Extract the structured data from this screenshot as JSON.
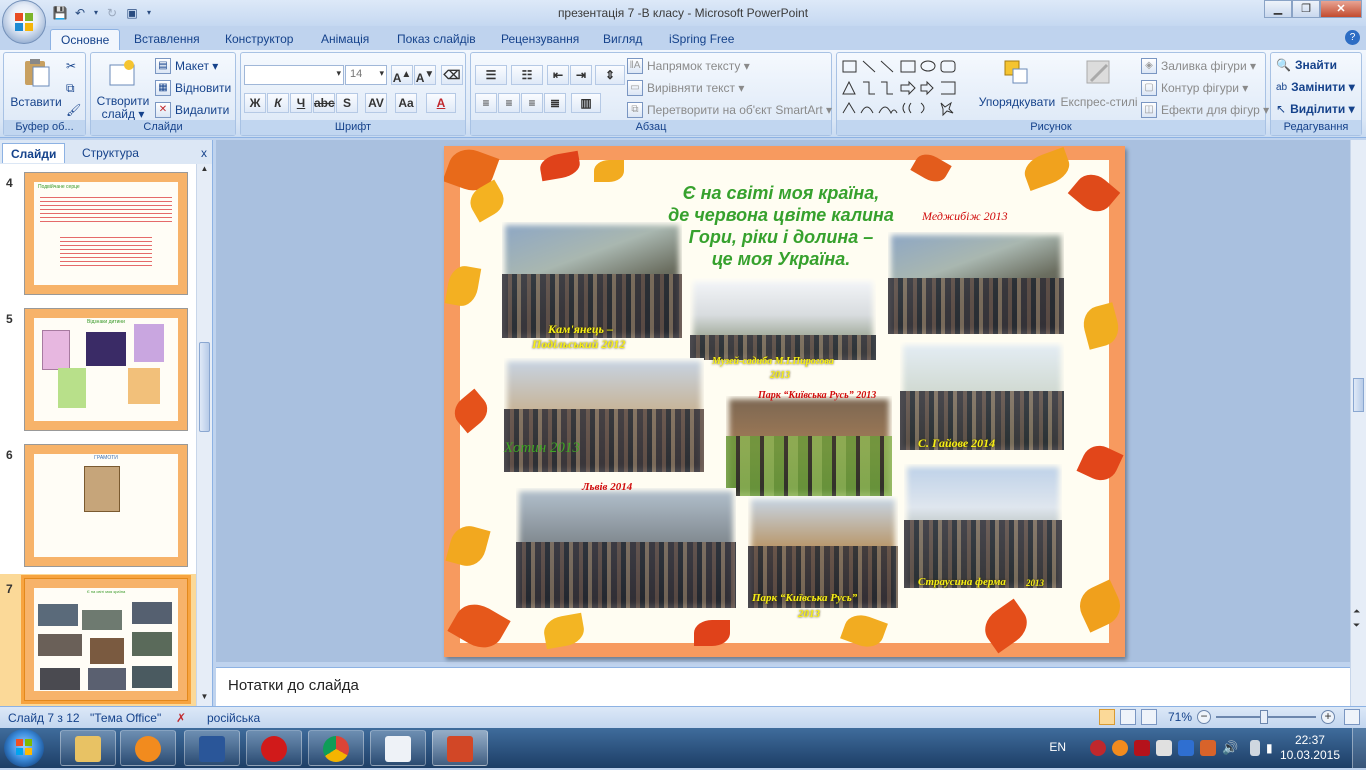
{
  "window": {
    "title": "презентація 7 -В класу  -  Microsoft PowerPoint",
    "controls": {
      "minimize": "▁",
      "maximize": "❐",
      "close": "✕"
    }
  },
  "ribbon_tabs": [
    "Основне",
    "Вставлення",
    "Конструктор",
    "Анімація",
    "Показ слайдів",
    "Рецензування",
    "Вигляд",
    "iSpring Free"
  ],
  "ribbon": {
    "clipboard": {
      "paste": "Вставити",
      "label": "Буфер об..."
    },
    "slides": {
      "new_slide": "Створити слайд ▾",
      "layout": "Макет ▾",
      "reset": "Відновити",
      "delete": "Видалити",
      "label": "Слайди"
    },
    "font": {
      "font_name": "",
      "font_size": "14",
      "label": "Шрифт"
    },
    "paragraph": {
      "text_direction": "Напрямок тексту ▾",
      "align_text": "Вирівняти текст ▾",
      "smartart": "Перетворити на об'єкт SmartArt ▾",
      "label": "Абзац"
    },
    "drawing": {
      "arrange": "Упорядкувати",
      "quick_styles": "Експрес-стилі",
      "fill": "Заливка фігури ▾",
      "outline": "Контур фігури ▾",
      "effects": "Ефекти для фігур ▾",
      "label": "Рисунок"
    },
    "editing": {
      "find": "Знайти",
      "replace": "Замінити ▾",
      "select": "Виділити ▾",
      "label": "Редагування"
    }
  },
  "left_pane": {
    "tabs": [
      "Слайди",
      "Структура"
    ],
    "close": "x",
    "thumbnails": [
      {
        "number": "4",
        "title": "Подвійчане серце"
      },
      {
        "number": "5",
        "title": "Відзнаки дитини"
      },
      {
        "number": "6",
        "title": "ГРАМОТИ"
      },
      {
        "number": "7",
        "title": "Є на світі моя країна"
      }
    ]
  },
  "slide": {
    "heading": [
      "Є на світі моя країна,",
      "де червона цвіте калина",
      "Гори, ріки і долина –",
      "це моя Україна."
    ],
    "captions": {
      "kamianets": "Кам'янець –",
      "kamianets2": "Подільський 2012",
      "medzhybizh": "Меджибіж 2013",
      "museum": "Музей-садиба М.І.Пирогова",
      "museum_year": "2013",
      "khotyn": "Хотин 2013",
      "kyivska_rus_top": "Парк “Київська Русь” 2013",
      "haiove": "С. Гайове 2014",
      "lviv": "Львів  2014",
      "kyivska_rus_bottom": "Парк “Київська  Русь”",
      "kyivska_rus_bottom_year": "2013",
      "ostrich": "Страусина ферма",
      "ostrich_year": "2013"
    }
  },
  "notes": {
    "placeholder": "Нотатки до слайда"
  },
  "status_bar": {
    "slide_info": "Слайд 7 з 12",
    "theme": "\"Тема Office\"",
    "language": "російська",
    "zoom": "71%"
  },
  "taskbar": {
    "language": "EN",
    "time": "22:37",
    "date": "10.03.2015"
  }
}
